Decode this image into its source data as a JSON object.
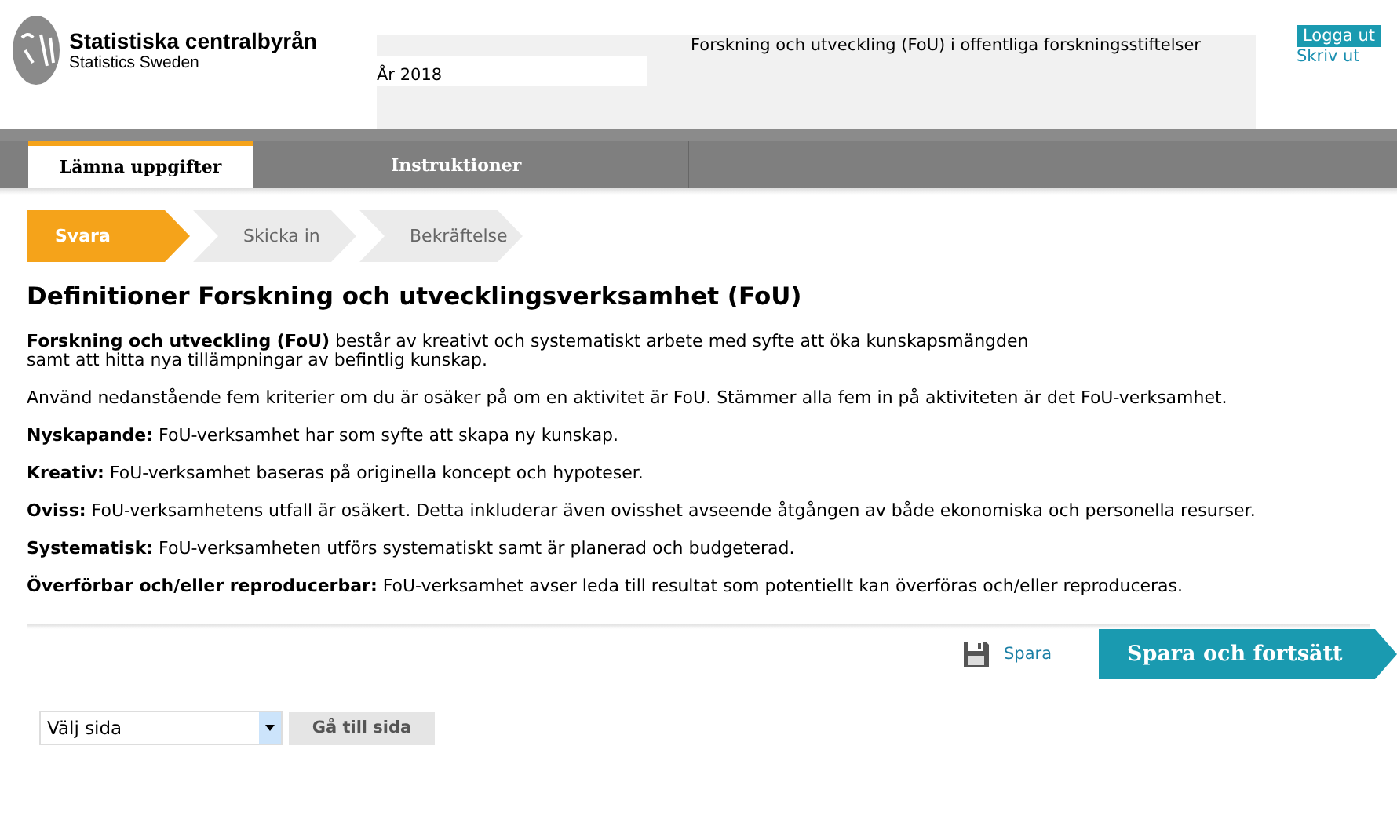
{
  "header": {
    "org_name": "Statistiska centralbyrån",
    "org_subtitle": "Statistics Sweden",
    "survey_title": "Forskning och utveckling (FoU) i offentliga forskningsstiftelser",
    "year": "År 2018",
    "logout": "Logga ut",
    "print": "Skriv ut"
  },
  "tabs": [
    {
      "label": "Lämna uppgifter",
      "selected": true
    },
    {
      "label": "Instruktioner",
      "selected": false
    }
  ],
  "steps": [
    {
      "label": "Svara",
      "selected": true
    },
    {
      "label": "Skicka in",
      "selected": false
    },
    {
      "label": "Bekräftelse",
      "selected": false
    }
  ],
  "heading": "Definitioner Forskning och utvecklingsverksamhet (FoU)",
  "paragraphs": [
    "**Forskning och utveckling (FoU)** består av kreativt och systematiskt arbete med syfte att öka kunskapsmängden\nsamt att hitta nya tillämpningar av befintlig kunskap.",
    "Använd nedanstående fem kriterier om du är osäker på om en aktivitet är FoU. Stämmer alla fem in på aktiviteten är det FoU-verksamhet.",
    "**Nyskapande:** FoU-verksamhet har som syfte att skapa ny kunskap.",
    "**Kreativ:** FoU-verksamhet baseras på originella koncept och hypoteser.",
    "**Oviss:** FoU-verksamhetens utfall är osäkert. Detta inkluderar även ovisshet avseende åtgången av både ekonomiska och personella resurser.",
    "**Systematisk:** FoU-verksamheten utförs systematiskt samt är planerad och budgeterad.",
    "**Överförbar och/eller reproducerbar:** FoU-verksamhet avser leda till resultat som potentiellt kan överföras och/eller reproduceras."
  ],
  "actions": {
    "save": "Spara",
    "save_continue": "Spara och fortsätt"
  },
  "page_select": {
    "value": "Välj sida",
    "go_button": "Gå till sida"
  }
}
